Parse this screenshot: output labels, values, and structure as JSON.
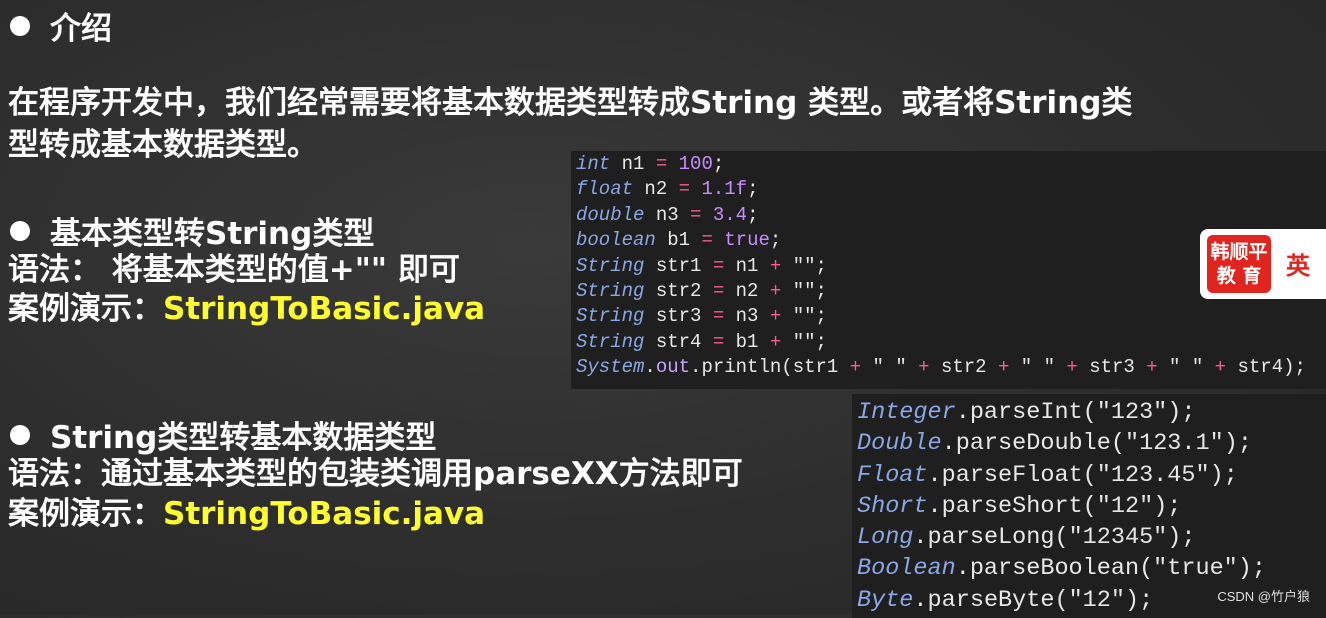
{
  "section_intro": {
    "heading": "介绍",
    "paragraph_line1": "在程序开发中，我们经常需要将基本数据类型转成String 类型。或者将String类",
    "paragraph_line2": "型转成基本数据类型。"
  },
  "section_to_string": {
    "heading": "基本类型转String类型",
    "syntax": "语法： 将基本类型的值+\"\" 即可",
    "demo_label": "案例演示：",
    "demo_file": "StringToBasic.java"
  },
  "section_to_basic": {
    "heading": "String类型转基本数据类型",
    "syntax": "语法：通过基本类型的包装类调用parseXX方法即可",
    "demo_label": "案例演示：",
    "demo_file": "StringToBasic.java"
  },
  "code_block_1": [
    "int n1 = 100;",
    "float n2 = 1.1f;",
    "double n3 = 3.4;",
    "boolean b1 = true;",
    "String str1 = n1 + \"\";",
    "String str2 = n2 + \"\";",
    "String str3 = n3 + \"\";",
    "String str4 = b1 + \"\";",
    "System.out.println(str1 + \" \" + str2 + \" \" + str3 + \" \" + str4);"
  ],
  "code_block_2": [
    "Integer.parseInt(\"123\");",
    "Double.parseDouble(\"123.1\");",
    "Float.parseFloat(\"123.45\");",
    "Short.parseShort(\"12\");",
    "Long.parseLong(\"12345\");",
    "Boolean.parseBoolean(\"true\");",
    "Byte.parseByte(\"12\");"
  ],
  "badge": {
    "line1": "韩顺平",
    "line2": "教 育",
    "side": "英"
  },
  "watermark": "CSDN @竹户狼"
}
